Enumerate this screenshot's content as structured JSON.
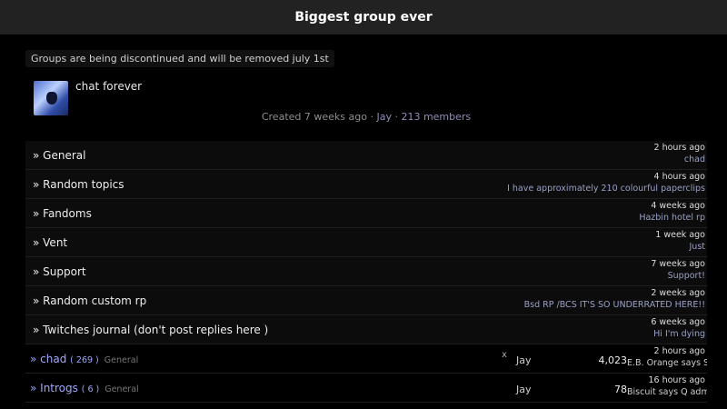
{
  "header": {
    "title": "Biggest group ever"
  },
  "notice": "Groups are being discontinued and will be removed july 1st",
  "group": {
    "name": "chat forever",
    "created": "Created 7 weeks ago",
    "sep1": " · ",
    "owner": "Jay",
    "sep2": " · ",
    "members": "213 members"
  },
  "forums": [
    {
      "title": "» General",
      "time": "2 hours ago",
      "last": "chad"
    },
    {
      "title": "» Random topics",
      "time": "4 hours ago",
      "last": "I have approximately 210 colourful paperclips"
    },
    {
      "title": "» Fandoms",
      "time": "4 weeks ago",
      "last": "Hazbin hotel rp"
    },
    {
      "title": "» Vent",
      "time": "1 week ago",
      "last": "Just"
    },
    {
      "title": "» Support",
      "time": "7 weeks ago",
      "last": "Support!"
    },
    {
      "title": "» Random custom rp",
      "time": "2 weeks ago",
      "last": "Bsd RP /BCS IT'S SO UNDERRATED HERE!!"
    },
    {
      "title": "» Twitches journal (don't post replies here )",
      "time": "6 weeks ago",
      "last": "Hi I'm dying"
    }
  ],
  "chats": [
    {
      "prefix": "» ",
      "name": "chad",
      "count": "( 269 )",
      "category": "General",
      "x": "x",
      "author": "Jay",
      "num": "4,023",
      "time": "2 hours ago",
      "last": "E.B. Orange says SAY"
    },
    {
      "prefix": "» ",
      "name": "Introgs",
      "count": "( 6 )",
      "category": "General",
      "x": "",
      "author": "Jay",
      "num": "78",
      "time": "16 hours ago",
      "last": "Biscuit says Q admin"
    }
  ]
}
